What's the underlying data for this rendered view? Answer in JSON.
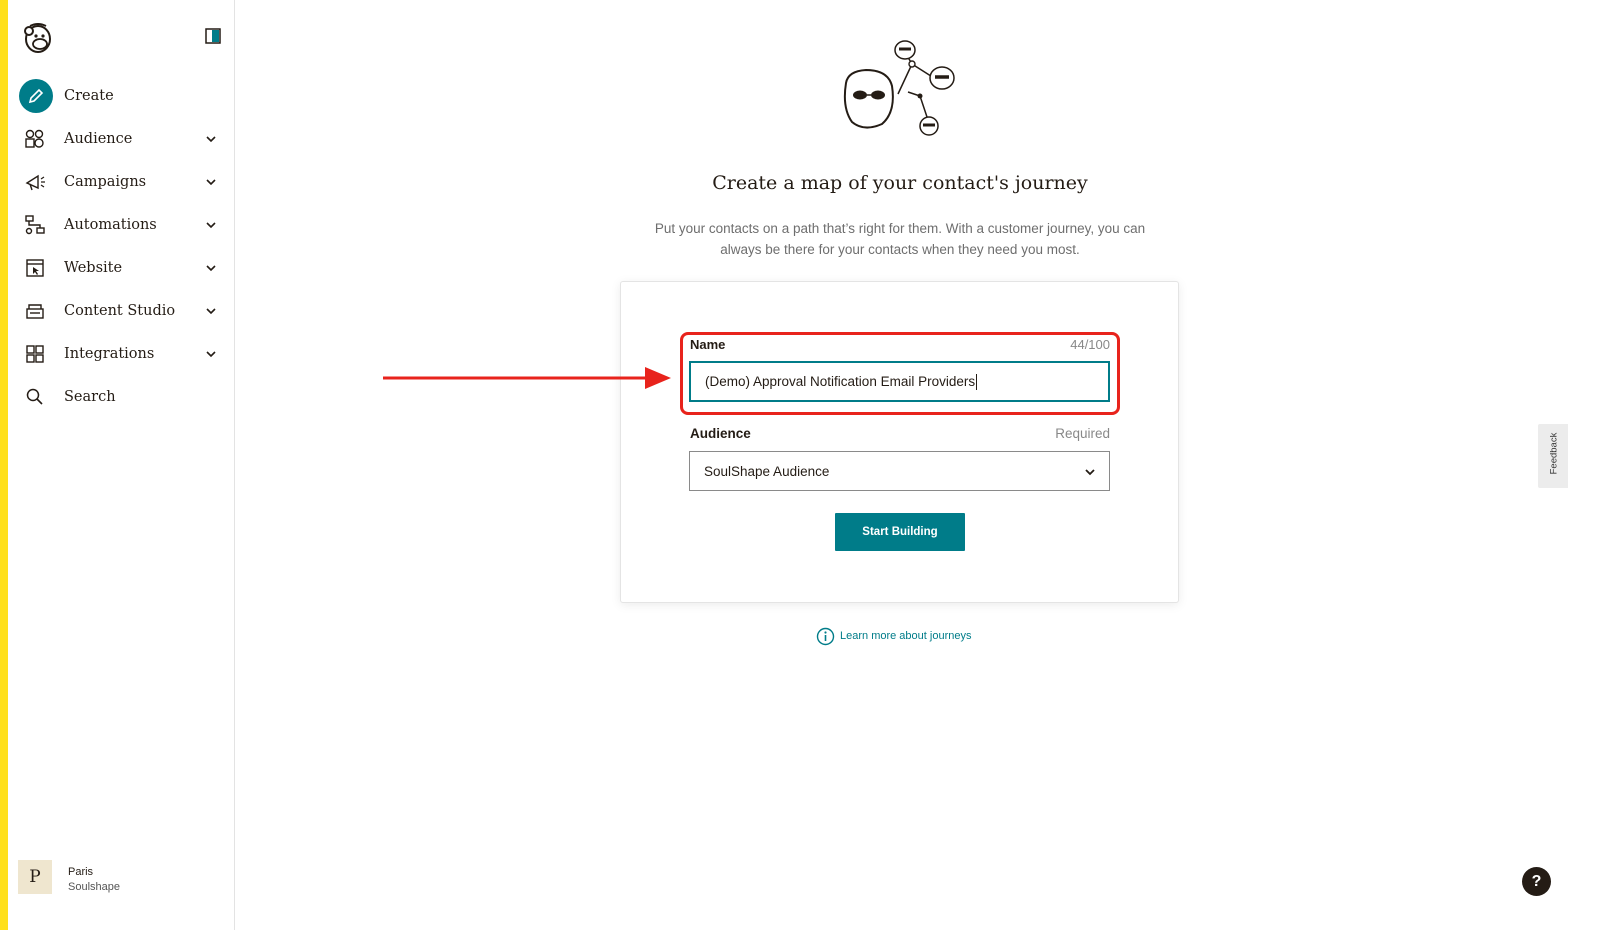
{
  "sidebar": {
    "items": [
      {
        "label": "Create",
        "icon": "pencil-icon"
      },
      {
        "label": "Audience",
        "icon": "audience-icon"
      },
      {
        "label": "Campaigns",
        "icon": "megaphone-icon"
      },
      {
        "label": "Automations",
        "icon": "automations-icon"
      },
      {
        "label": "Website",
        "icon": "website-icon"
      },
      {
        "label": "Content Studio",
        "icon": "content-studio-icon"
      },
      {
        "label": "Integrations",
        "icon": "grid-icon"
      },
      {
        "label": "Search",
        "icon": "search-icon"
      }
    ],
    "user": {
      "initial": "P",
      "name": "Paris",
      "org": "Soulshape"
    }
  },
  "main": {
    "title": "Create a map of your contact's journey",
    "subtitle_line1": "Put your contacts on a path that’s right for them. With a customer journey, you can",
    "subtitle_line2": "always be there for your contacts when they need you most.",
    "form": {
      "name_label": "Name",
      "name_count": "44/100",
      "name_value": "(Demo) Approval Notification Email Providers",
      "audience_label": "Audience",
      "audience_required": "Required",
      "audience_value": "SoulShape Audience",
      "submit_label": "Start Building"
    },
    "learn_more": "Learn more about journeys"
  },
  "feedback_label": "Feedback",
  "help_label": "?",
  "colors": {
    "accent": "#007c89",
    "highlight": "#e8231c",
    "brand_yellow": "#ffe01b"
  }
}
